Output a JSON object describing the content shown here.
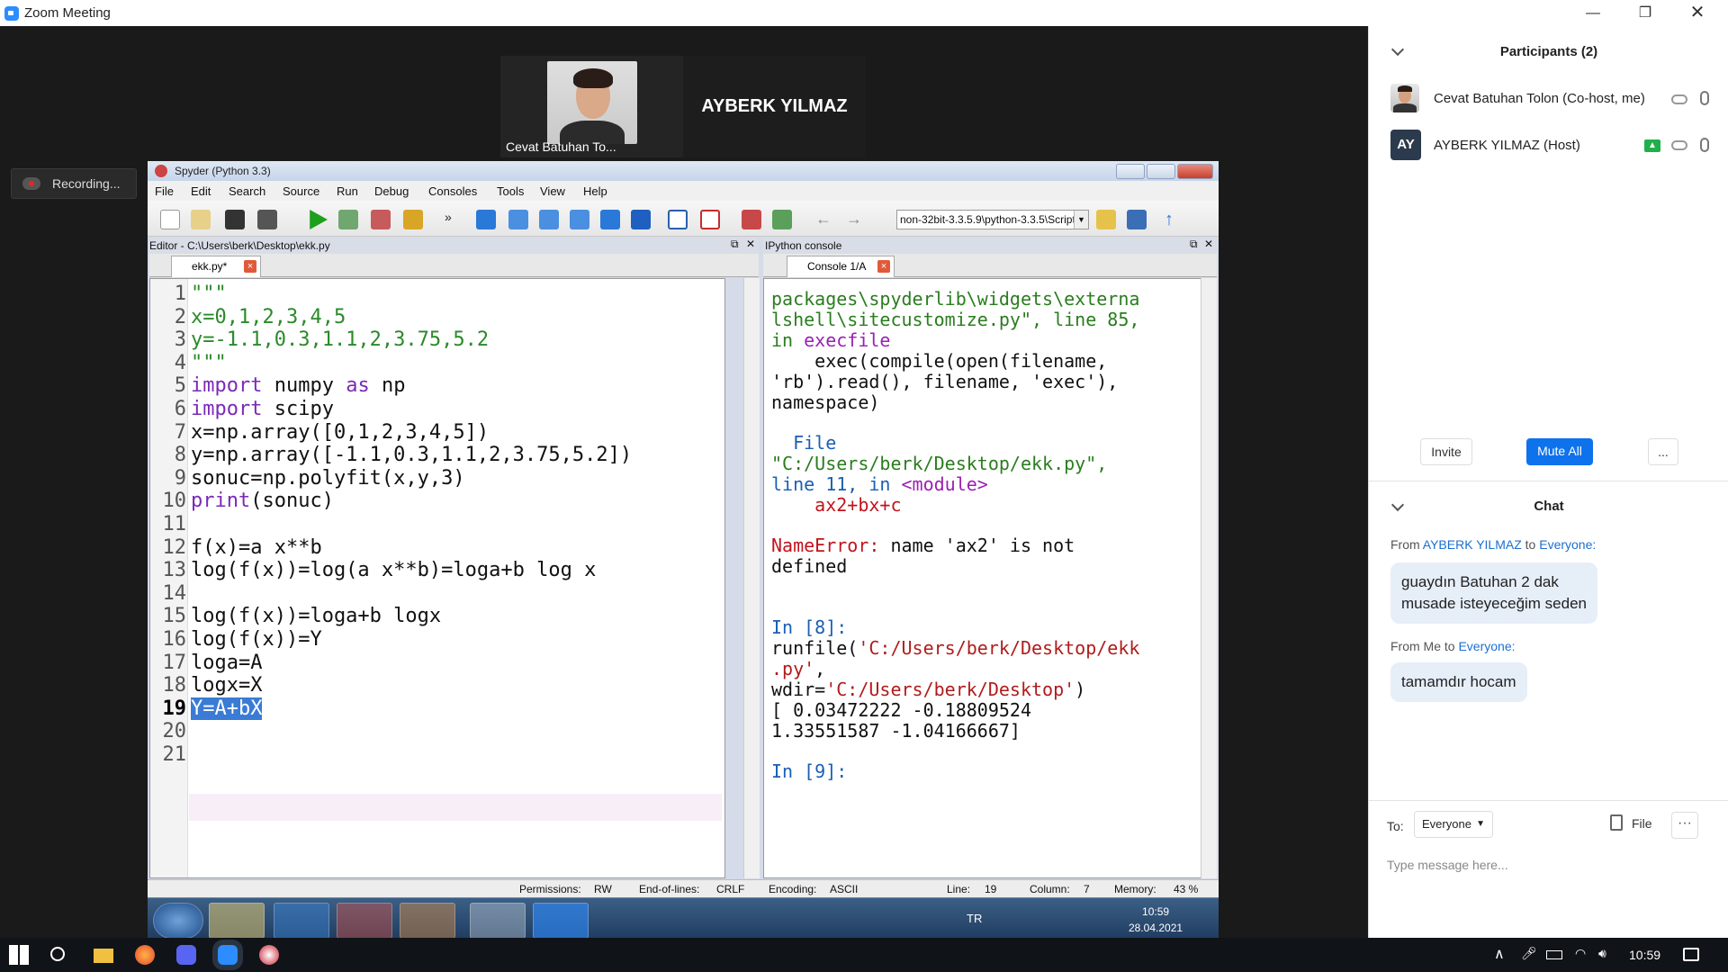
{
  "window": {
    "title": "Zoom Meeting"
  },
  "video": {
    "tile1_name": "Cevat Batuhan To...",
    "tile2_name": "AYBERK YILMAZ",
    "recording": "Recording..."
  },
  "spyder": {
    "title": "Spyder (Python 3.3)",
    "menu": [
      "File",
      "Edit",
      "Search",
      "Source",
      "Run",
      "Debug",
      "Consoles",
      "Tools",
      "View",
      "Help"
    ],
    "path": "non-32bit-3.3.5.9\\python-3.3.5\\Scripts",
    "editor_header": "Editor - C:\\Users\\berk\\Desktop\\ekk.py",
    "editor_tab": "ekk.py*",
    "console_header": "IPython console",
    "console_tab": "Console 1/A",
    "status": {
      "permissions_label": "Permissions:",
      "permissions": "RW",
      "eol_label": "End-of-lines:",
      "eol": "CRLF",
      "encoding_label": "Encoding:",
      "encoding": "ASCII",
      "line_label": "Line:",
      "line": "19",
      "column_label": "Column:",
      "column": "7",
      "memory_label": "Memory:",
      "memory": "43 %"
    },
    "win7": {
      "lang": "TR",
      "time": "10:59",
      "date": "28.04.2021"
    }
  },
  "code": [
    {
      "n": "1",
      "t": "\"\"\""
    },
    {
      "n": "2",
      "t": "x=0,1,2,3,4,5"
    },
    {
      "n": "3",
      "t": "y=-1.1,0.3,1.1,2,3.75,5.2"
    },
    {
      "n": "4",
      "t": "\"\"\""
    },
    {
      "n": "5",
      "t": "import numpy as np"
    },
    {
      "n": "6",
      "t": "import scipy"
    },
    {
      "n": "7",
      "t": "x=np.array([0,1,2,3,4,5])"
    },
    {
      "n": "8",
      "t": "y=np.array([-1.1,0.3,1.1,2,3.75,5.2])"
    },
    {
      "n": "9",
      "t": "sonuc=np.polyfit(x,y,3)"
    },
    {
      "n": "10",
      "t": "print(sonuc)"
    },
    {
      "n": "11",
      "t": ""
    },
    {
      "n": "12",
      "t": "f(x)=a x**b"
    },
    {
      "n": "13",
      "t": "log(f(x))=log(a x**b)=loga+b log x"
    },
    {
      "n": "14",
      "t": ""
    },
    {
      "n": "15",
      "t": "log(f(x))=loga+b logx"
    },
    {
      "n": "16",
      "t": "log(f(x))=Y"
    },
    {
      "n": "17",
      "t": "loga=A"
    },
    {
      "n": "18",
      "t": "logx=X"
    },
    {
      "n": "19",
      "t": "Y=A+bX"
    },
    {
      "n": "20",
      "t": ""
    },
    {
      "n": "21",
      "t": ""
    }
  ],
  "console": {
    "l1": "packages\\spyderlib\\widgets\\externa",
    "l2": "lshell\\sitecustomize.py\", line 85,",
    "l3a": "in ",
    "l3b": "execfile",
    "l4": "    exec(compile(open(filename,",
    "l5": "'rb').read(), filename, 'exec'),",
    "l6": "namespace)",
    "l7": "  File",
    "l8": "\"C:/Users/berk/Desktop/ekk.py\",",
    "l9a": "line 11, in ",
    "l9b": "<module>",
    "l10": "    ax2+bx+c",
    "l11a": "NameError:",
    "l11b": " name 'ax2' is not",
    "l12": "defined",
    "l13": "In [8]:",
    "l14a": "runfile(",
    "l14b": "'C:/Users/berk/Desktop/ekk",
    "l15a": ".py'",
    "l15b": ",",
    "l16a": "wdir=",
    "l16b": "'C:/Users/berk/Desktop'",
    "l16c": ")",
    "l17": "[ 0.03472222 -0.18809524",
    "l18": "1.33551587 -1.04166667]",
    "l19": "In [9]:"
  },
  "panel": {
    "participants_title": "Participants (2)",
    "p1": "Cevat Batuhan Tolon (Co-host, me)",
    "p2": "AYBERK YILMAZ (Host)",
    "p2_initials": "AY",
    "invite": "Invite",
    "mute_all": "Mute All",
    "more": "...",
    "chat_title": "Chat",
    "m1_from": "From",
    "m1_sender": "AYBERK YILMAZ",
    "m1_to": "to",
    "m1_target": "Everyone:",
    "m1_text1": "guaydın Batuhan 2 dak",
    "m1_text2": "musade isteyeceğim seden",
    "m2_from": "From Me to",
    "m2_target": "Everyone:",
    "m2_text": "tamamdır hocam",
    "to_label": "To:",
    "to_value": "Everyone",
    "file_label": "File",
    "type_placeholder": "Type message here..."
  },
  "taskbar": {
    "time": "10:59"
  },
  "colors": {
    "zoom_blue": "#2d8cff",
    "chat_link": "#1b6fd1",
    "keyword": "#7a2ab8",
    "string": "#2a8a2a"
  }
}
